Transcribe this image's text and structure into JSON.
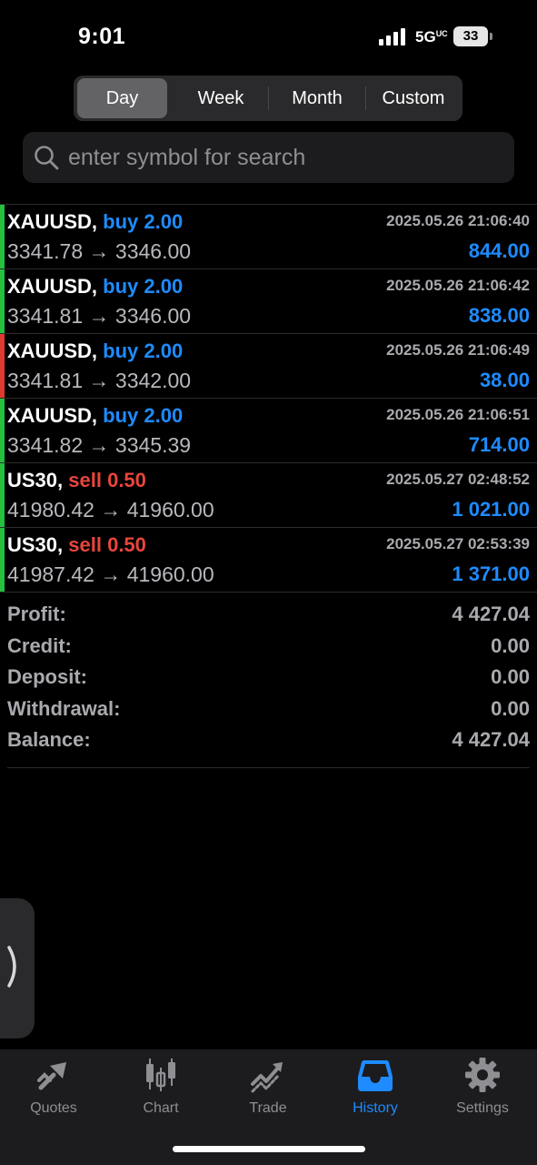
{
  "status": {
    "time": "9:01",
    "network": "5G",
    "network_sup": "UC",
    "battery": "33"
  },
  "tabs": [
    {
      "label": "Day",
      "active": true
    },
    {
      "label": "Week",
      "active": false
    },
    {
      "label": "Month",
      "active": false
    },
    {
      "label": "Custom",
      "active": false
    }
  ],
  "search": {
    "placeholder": "enter symbol for search"
  },
  "deals": [
    {
      "symbol": "XAUUSD,",
      "side": "buy 2.00",
      "side_color": "#1e8bff",
      "bar_color": "#25c03d",
      "date": "2025.05.26 21:06:40",
      "prices": "3341.78 → 3346.00",
      "profit": "844.00"
    },
    {
      "symbol": "XAUUSD,",
      "side": "buy 2.00",
      "side_color": "#1e8bff",
      "bar_color": "#25c03d",
      "date": "2025.05.26 21:06:42",
      "prices": "3341.81 → 3346.00",
      "profit": "838.00"
    },
    {
      "symbol": "XAUUSD,",
      "side": "buy 2.00",
      "side_color": "#1e8bff",
      "bar_color": "#e03a30",
      "date": "2025.05.26 21:06:49",
      "prices": "3341.81 → 3342.00",
      "profit": "38.00"
    },
    {
      "symbol": "XAUUSD,",
      "side": "buy 2.00",
      "side_color": "#1e8bff",
      "bar_color": "#25c03d",
      "date": "2025.05.26 21:06:51",
      "prices": "3341.82 → 3345.39",
      "profit": "714.00"
    },
    {
      "symbol": "US30,",
      "side": "sell 0.50",
      "side_color": "#e8453c",
      "bar_color": "#25c03d",
      "date": "2025.05.27 02:48:52",
      "prices": "41980.42 → 41960.00",
      "profit": "1 021.00"
    },
    {
      "symbol": "US30,",
      "side": "sell 0.50",
      "side_color": "#e8453c",
      "bar_color": "#25c03d",
      "date": "2025.05.27 02:53:39",
      "prices": "41987.42 → 41960.00",
      "profit": "1 371.00"
    }
  ],
  "summary": [
    {
      "label": "Profit:",
      "value": "4 427.04"
    },
    {
      "label": "Credit:",
      "value": "0.00"
    },
    {
      "label": "Deposit:",
      "value": "0.00"
    },
    {
      "label": "Withdrawal:",
      "value": "0.00"
    },
    {
      "label": "Balance:",
      "value": "4 427.04"
    }
  ],
  "nav": [
    {
      "label": "Quotes",
      "icon": "quotes-icon",
      "active": false
    },
    {
      "label": "Chart",
      "icon": "chart-icon",
      "active": false
    },
    {
      "label": "Trade",
      "icon": "trade-icon",
      "active": false
    },
    {
      "label": "History",
      "icon": "history-icon",
      "active": true
    },
    {
      "label": "Settings",
      "icon": "gear-icon",
      "active": false
    }
  ],
  "colors": {
    "accent": "#1e8bff",
    "buy": "#1e8bff",
    "sell": "#e8453c",
    "profit_bar": "#25c03d",
    "loss_bar": "#e03a30"
  }
}
